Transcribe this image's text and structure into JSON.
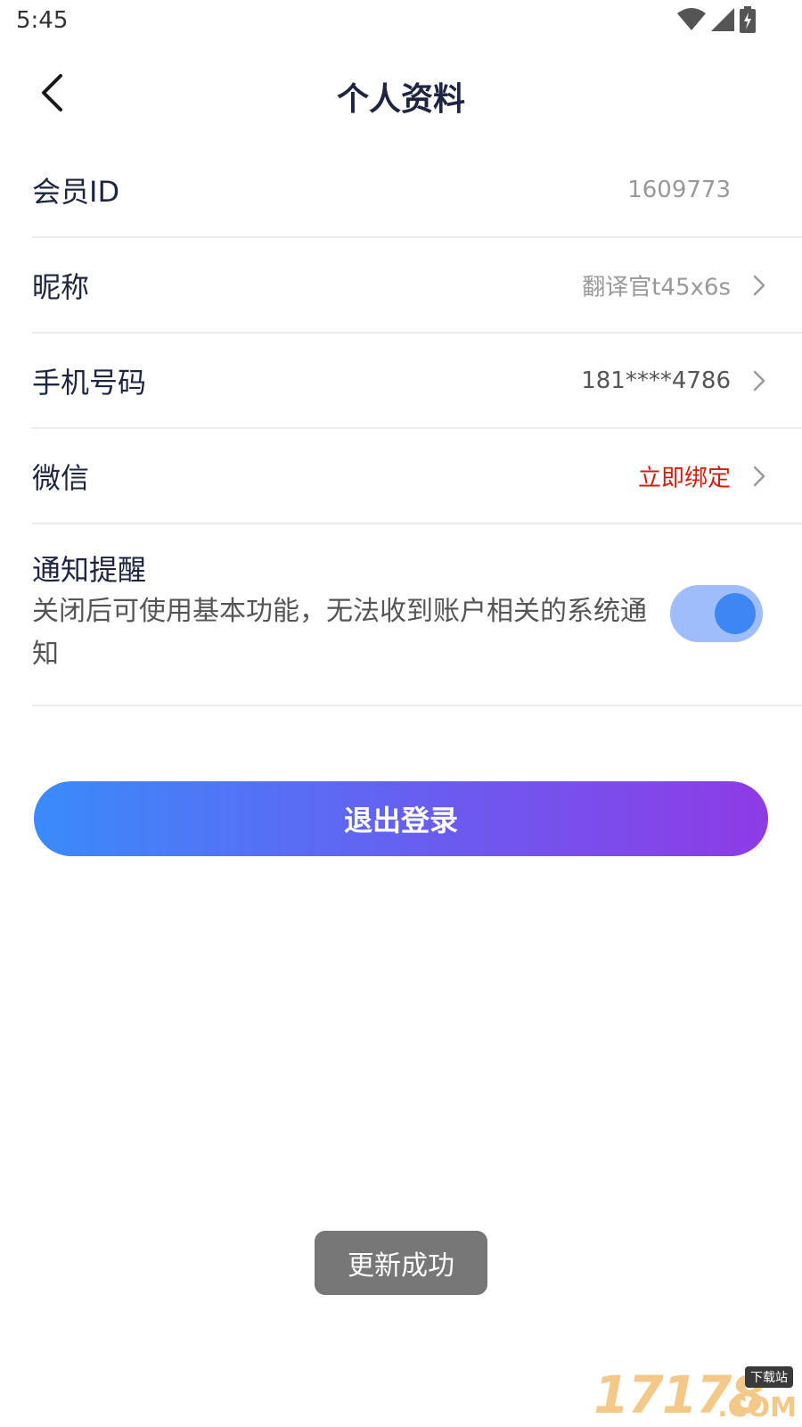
{
  "status_bar": {
    "time": "5:45",
    "icons": [
      "wifi-icon",
      "signal-icon",
      "battery-charging-icon"
    ]
  },
  "header": {
    "title": "个人资料",
    "back_icon": "chevron-left-icon"
  },
  "rows": [
    {
      "label": "会员ID",
      "value": "1609773"
    },
    {
      "label": "昵称",
      "value": "翻译官t45x6s"
    },
    {
      "label": "手机号码",
      "value": "181****4786"
    },
    {
      "label": "微信",
      "value": "立即绑定"
    }
  ],
  "notification": {
    "title": "通知提醒",
    "description": "关闭后可使用基本功能，无法收到账户相关的系统通知",
    "enabled": true
  },
  "logout": {
    "label": "退出登录"
  },
  "toast": {
    "message": "更新成功"
  },
  "watermark": {
    "number": "17178",
    "badge": "下载站",
    "suffix": ".COM"
  },
  "colors": {
    "title": "#1f2540",
    "value_grey": "#999999",
    "bind_red": "#d21e0a",
    "toggle_track": "#9fbdfb",
    "toggle_knob": "#3f86f5",
    "gradient_start": "#3a8bfb",
    "gradient_end": "#8e3be6"
  }
}
